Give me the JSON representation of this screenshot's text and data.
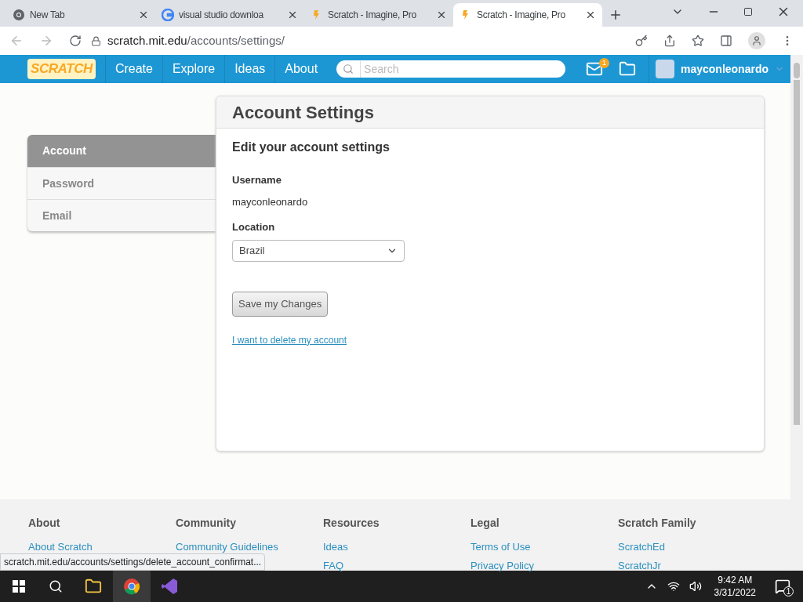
{
  "browser": {
    "tabs": [
      {
        "title": "New Tab",
        "kind": "chrome",
        "selected": false
      },
      {
        "title": "visual studio downloa",
        "kind": "google",
        "selected": false
      },
      {
        "title": "Scratch - Imagine, Pro",
        "kind": "scratch",
        "selected": false
      },
      {
        "title": "Scratch - Imagine, Pro",
        "kind": "scratch",
        "selected": true
      }
    ],
    "address": {
      "host": "scratch.mit.edu",
      "path": "/accounts/settings/"
    },
    "status_url": "scratch.mit.edu/accounts/settings/delete_account_confirmat..."
  },
  "navbar": {
    "logo": "SCRATCH",
    "links": [
      "Create",
      "Explore",
      "Ideas",
      "About"
    ],
    "search": {
      "placeholder": "Search"
    },
    "message_count": "1",
    "username": "mayconleonardo"
  },
  "sidebar": {
    "items": [
      {
        "label": "Account",
        "selected": true
      },
      {
        "label": "Password",
        "selected": false
      },
      {
        "label": "Email",
        "selected": false
      }
    ]
  },
  "settings": {
    "title": "Account Settings",
    "subtitle": "Edit your account settings",
    "username_label": "Username",
    "username": "mayconleonardo",
    "location_label": "Location",
    "location": "Brazil",
    "save_button": "Save my Changes",
    "delete_link": "I want to delete my account"
  },
  "footer": {
    "columns": [
      {
        "heading": "About",
        "links": [
          "About Scratch"
        ]
      },
      {
        "heading": "Community",
        "links": [
          "Community Guidelines"
        ]
      },
      {
        "heading": "Resources",
        "links": [
          "Ideas",
          "FAQ"
        ]
      },
      {
        "heading": "Legal",
        "links": [
          "Terms of Use",
          "Privacy Policy"
        ]
      },
      {
        "heading": "Scratch Family",
        "links": [
          "ScratchEd",
          "ScratchJr"
        ]
      }
    ]
  },
  "taskbar": {
    "time": "9:42 AM",
    "date": "3/31/2022",
    "notification_count": "1"
  }
}
